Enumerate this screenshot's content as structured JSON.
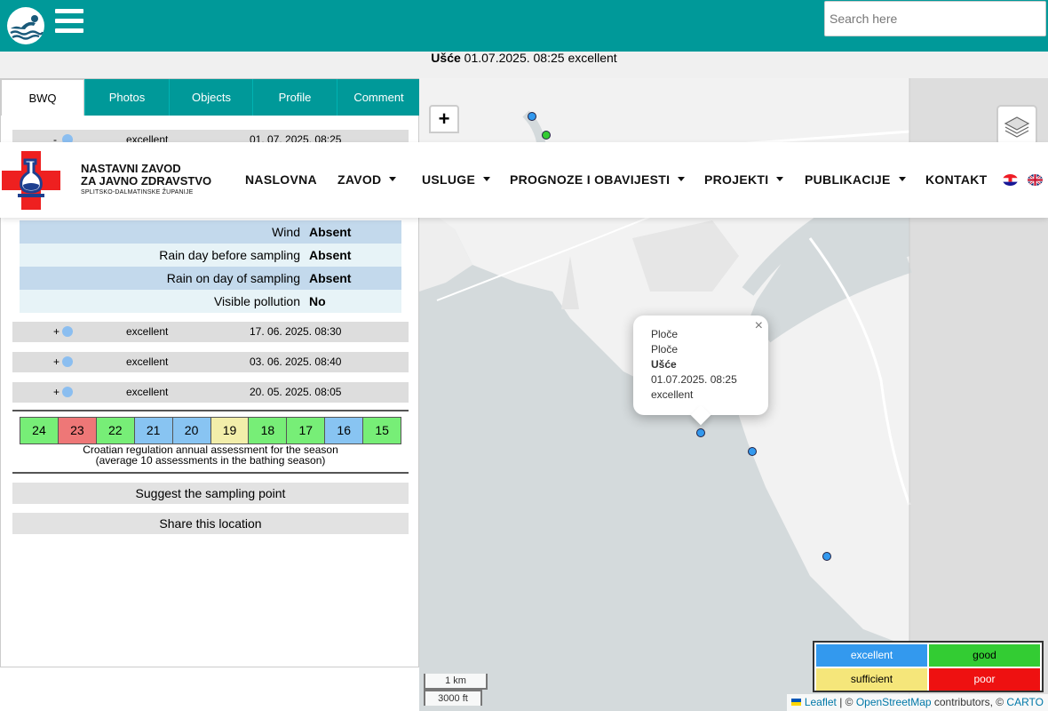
{
  "topbar": {
    "search_placeholder": "Search here"
  },
  "status": {
    "location": "Ušće",
    "datetime": "01.07.2025. 08:25",
    "quality": "excellent"
  },
  "tabs": [
    {
      "label": "BWQ",
      "active": true
    },
    {
      "label": "Photos"
    },
    {
      "label": "Objects"
    },
    {
      "label": "Profile"
    },
    {
      "label": "Comment"
    }
  ],
  "samples": [
    {
      "sign": "-",
      "quality": "excellent",
      "date": "01. 07. 2025. 08:25"
    },
    {
      "sign": "+",
      "quality": "excellent",
      "date": "17. 06. 2025. 08:30"
    },
    {
      "sign": "+",
      "quality": "excellent",
      "date": "03. 06. 2025. 08:40"
    },
    {
      "sign": "+",
      "quality": "excellent",
      "date": "20. 05. 2025. 08:05"
    }
  ],
  "details": [
    {
      "label": "Wind",
      "value": "Absent"
    },
    {
      "label": "Rain day before sampling",
      "value": "Absent"
    },
    {
      "label": "Rain on day of sampling",
      "value": "Absent"
    },
    {
      "label": "Visible pollution",
      "value": "No"
    }
  ],
  "assessment": {
    "years": [
      {
        "value": "24",
        "color": "#77ee77"
      },
      {
        "value": "23",
        "color": "#ee7777"
      },
      {
        "value": "22",
        "color": "#77ee77"
      },
      {
        "value": "21",
        "color": "#88c4f2"
      },
      {
        "value": "20",
        "color": "#88c4f2"
      },
      {
        "value": "19",
        "color": "#f2eeaa"
      },
      {
        "value": "18",
        "color": "#77ee77"
      },
      {
        "value": "17",
        "color": "#77ee77"
      },
      {
        "value": "16",
        "color": "#88c4f2"
      },
      {
        "value": "15",
        "color": "#77ee77"
      }
    ],
    "caption_1": "Croatian regulation annual assessment for the season",
    "caption_2": "(average 10 assessments in the bathing season)"
  },
  "actions": {
    "suggest": "Suggest the sampling point",
    "share": "Share this location"
  },
  "map": {
    "zoom_in": "+",
    "popup": {
      "line1": "Ploče",
      "line2": "Ploče",
      "line3": "Ušće",
      "line4": "01.07.2025. 08:25",
      "line5": "excellent",
      "close": "×"
    },
    "scale_km": "1 km",
    "scale_ft": "3000 ft",
    "legend": {
      "excellent": "excellent",
      "good": "good",
      "sufficient": "sufficient",
      "poor": "poor"
    },
    "attribution": {
      "leaflet": "Leaflet",
      "sep1": " | © ",
      "osm": "OpenStreetMap",
      "sep2": " contributors, © ",
      "carto": "CARTO"
    }
  },
  "colors": {
    "teal": "#009999",
    "excellent": "#3399ee",
    "good": "#33cc33",
    "sufficient": "#f5e67a",
    "poor": "#ee1111"
  },
  "institute": {
    "name_line1": "NASTAVNI ZAVOD",
    "name_line2": "ZA JAVNO ZDRAVSTVO",
    "subtitle": "SPLITSKO-DALMATINSKE ŽUPANIJE"
  },
  "nav": {
    "naslovna": "NASLOVNA",
    "zavod": "ZAVOD",
    "usluge": "USLUGE",
    "prognoze": "PROGNOZE I OBAVIJESTI",
    "projekti": "PROJEKTI",
    "publikacije": "PUBLIKACIJE",
    "kontakt": "KONTAKT"
  }
}
